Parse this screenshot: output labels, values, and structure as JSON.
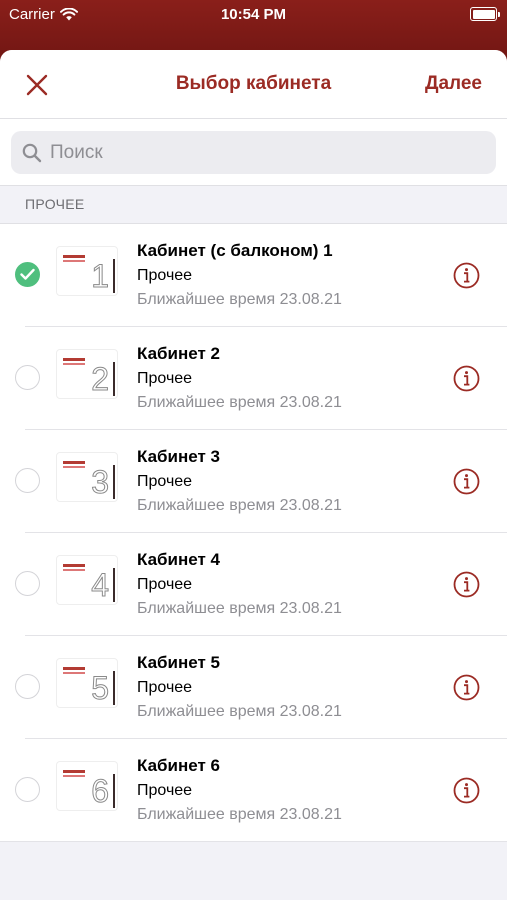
{
  "status_bar": {
    "carrier": "Carrier",
    "time": "10:54 PM"
  },
  "nav": {
    "title": "Выбор кабинета",
    "next_label": "Далее"
  },
  "search": {
    "placeholder": "Поиск",
    "value": ""
  },
  "section": {
    "header": "ПРОЧЕЕ"
  },
  "rooms": [
    {
      "title": "Кабинет (с балконом) 1",
      "category": "Прочее",
      "time": "Ближайшее время 23.08.21",
      "thumb_number": "1",
      "selected": true
    },
    {
      "title": "Кабинет 2",
      "category": "Прочее",
      "time": "Ближайшее время 23.08.21",
      "thumb_number": "2",
      "selected": false
    },
    {
      "title": "Кабинет 3",
      "category": "Прочее",
      "time": "Ближайшее время 23.08.21",
      "thumb_number": "3",
      "selected": false
    },
    {
      "title": "Кабинет 4",
      "category": "Прочее",
      "time": "Ближайшее время 23.08.21",
      "thumb_number": "4",
      "selected": false
    },
    {
      "title": "Кабинет 5",
      "category": "Прочее",
      "time": "Ближайшее время 23.08.21",
      "thumb_number": "5",
      "selected": false
    },
    {
      "title": "Кабинет 6",
      "category": "Прочее",
      "time": "Ближайшее время 23.08.21",
      "thumb_number": "6",
      "selected": false
    }
  ],
  "colors": {
    "accent": "#9b2b24",
    "selected": "#4fbf7e",
    "header_bg": "#8a1f1a"
  },
  "icons": {
    "close": "close-icon",
    "search": "search-icon",
    "info": "info-icon",
    "check": "checkmark-icon"
  }
}
